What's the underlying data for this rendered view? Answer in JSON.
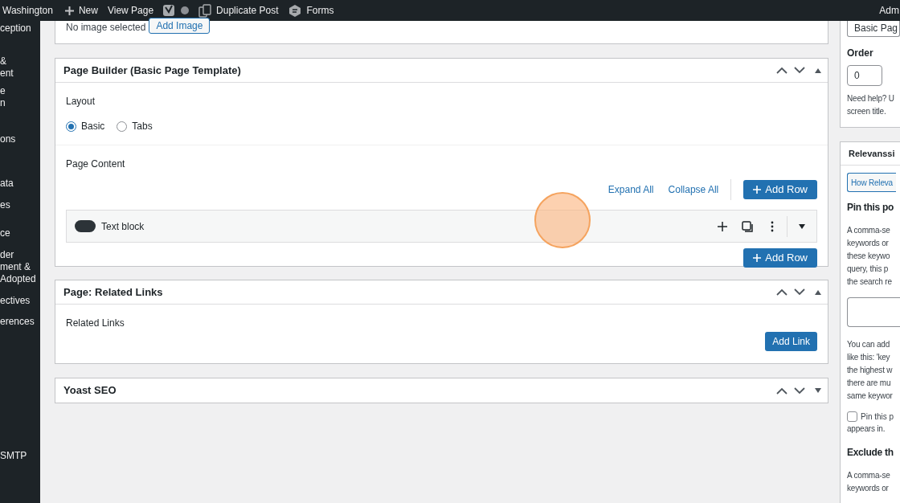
{
  "admin_bar": {
    "site": "Washington",
    "new": "New",
    "view": "View Page",
    "duplicate": "Duplicate Post",
    "forms": "Forms",
    "account": "Adm"
  },
  "sidebar": {
    "items": [
      {
        "lines": [
          "ception"
        ]
      },
      {
        "lines": [
          "&",
          "ent"
        ]
      },
      {
        "lines": [
          "e",
          "n"
        ]
      },
      {
        "lines": [
          "ons"
        ]
      },
      {
        "lines": [
          "ata"
        ]
      },
      {
        "lines": [
          "es"
        ]
      },
      {
        "lines": [
          "ce"
        ]
      },
      {
        "lines": [
          "der",
          "ment &",
          "Adopted"
        ]
      },
      {
        "lines": [
          "ectives"
        ]
      },
      {
        "lines": [
          "erences"
        ]
      },
      {
        "lines": [
          "SMTP"
        ]
      }
    ]
  },
  "image_panel": {
    "status": "No image selected",
    "button": "Add Image"
  },
  "page_builder": {
    "title": "Page Builder (Basic Page Template)",
    "expanded": true,
    "layout_label": "Layout",
    "layouts": [
      {
        "label": "Basic",
        "selected": true
      },
      {
        "label": "Tabs",
        "selected": false
      }
    ],
    "content_label": "Page Content",
    "expand_all": "Expand All",
    "collapse_all": "Collapse All",
    "add_row": "Add Row",
    "rows": [
      {
        "title": "Text block"
      }
    ],
    "add_row_bottom": "Add Row"
  },
  "related_links": {
    "title": "Page: Related Links",
    "expanded": true,
    "label": "Related Links",
    "button": "Add Link"
  },
  "yoast": {
    "title": "Yoast SEO",
    "expanded": false
  },
  "right": {
    "template_value": "Basic Pag",
    "order_label": "Order",
    "order_value": "0",
    "help_lines": [
      "Need help? U",
      "screen title."
    ],
    "relevanssi_title": "Relevanssi",
    "how_button": "How Releva",
    "pin_heading": "Pin this po",
    "pin_lines": [
      "A comma-se",
      "keywords or",
      "these keywo",
      "query, this p",
      "the search re"
    ],
    "add_lines": [
      "You can add",
      "like this: 'key",
      "the highest w",
      "there are mu",
      "same keywor"
    ],
    "pin_checkbox": {
      "label": "Pin this p",
      "checked": false
    },
    "pin_checkbox_tail": "appears in.",
    "exclude_heading": "Exclude th",
    "exclude_lines": [
      "A comma-se",
      "keywords or"
    ]
  }
}
